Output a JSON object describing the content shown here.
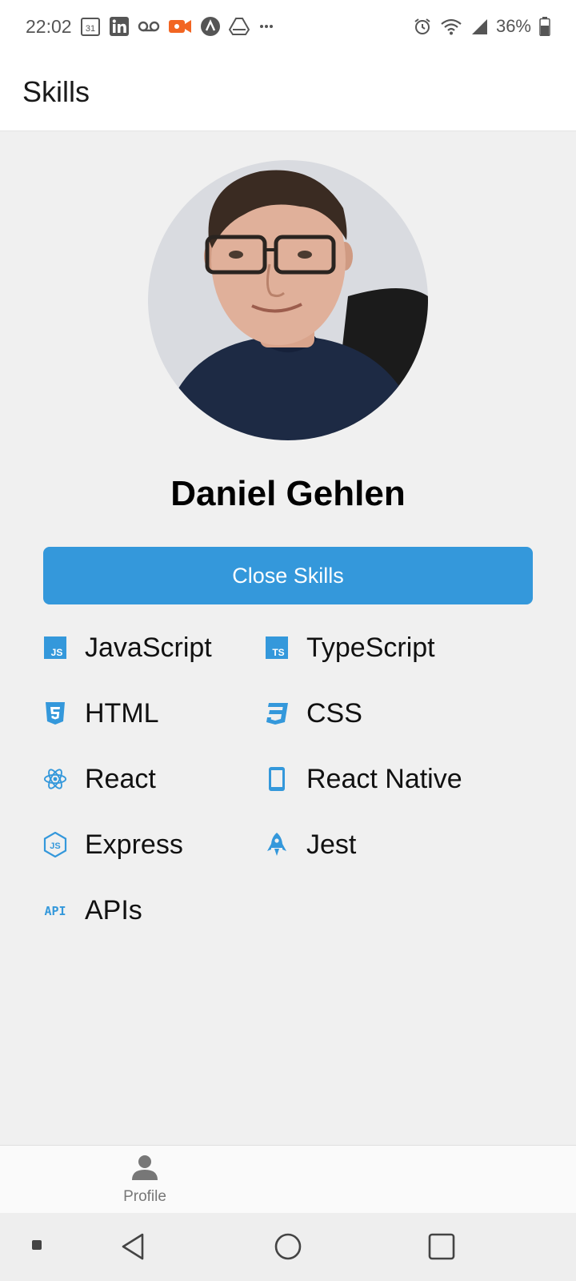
{
  "status_bar": {
    "time": "22:02",
    "calendar_day": "31",
    "battery": "36%"
  },
  "header": {
    "title": "Skills"
  },
  "profile": {
    "name": "Daniel Gehlen"
  },
  "actions": {
    "close_skills_label": "Close Skills"
  },
  "skills": [
    {
      "label": "JavaScript",
      "icon": "javascript-icon"
    },
    {
      "label": "TypeScript",
      "icon": "typescript-icon"
    },
    {
      "label": "HTML",
      "icon": "html5-icon"
    },
    {
      "label": "CSS",
      "icon": "css3-icon"
    },
    {
      "label": "React",
      "icon": "react-atom-icon"
    },
    {
      "label": "React Native",
      "icon": "mobile-phone-icon"
    },
    {
      "label": "Express",
      "icon": "nodejs-icon"
    },
    {
      "label": "Jest",
      "icon": "rocket-icon"
    },
    {
      "label": "APIs",
      "icon": "api-icon"
    }
  ],
  "tab_bar": {
    "profile_label": "Profile"
  },
  "colors": {
    "accent": "#3498db",
    "background": "#f0f0f0",
    "header_background": "#ffffff"
  }
}
